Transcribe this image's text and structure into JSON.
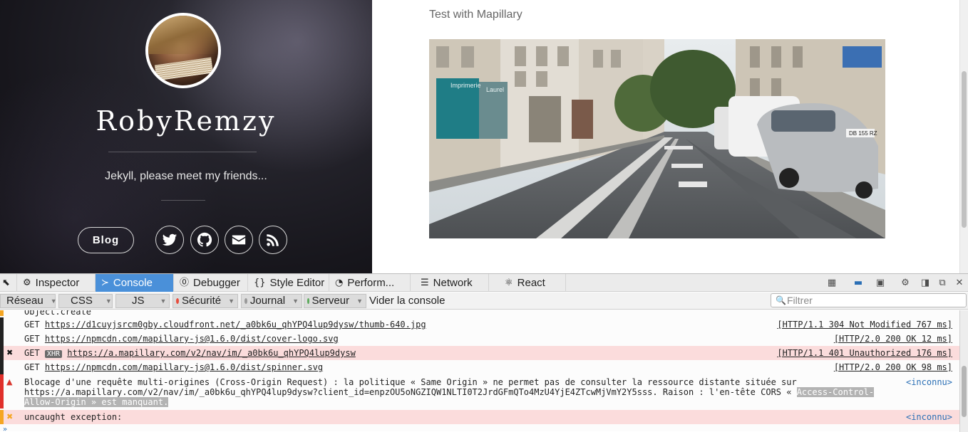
{
  "site": {
    "title": "RobyRemzy",
    "tagline": "Jekyll, please meet my friends...",
    "blog_label": "Blog",
    "social": [
      "twitter-icon",
      "github-icon",
      "envelope-icon",
      "rss-icon"
    ],
    "post_title": "Test with Mapillary",
    "shop_sign_1": "Imprimerie",
    "shop_sign_2": "Laurel",
    "car_plate": "DB 155 RZ"
  },
  "devtools": {
    "tabs": [
      "Inspector",
      "Console",
      "Debugger",
      "Style Editor",
      "Perform...",
      "Network",
      "React"
    ],
    "active_tab": "Console",
    "filters": {
      "reseau": "Réseau",
      "css": "CSS",
      "js": "JS",
      "securite": "Sécurité",
      "journal": "Journal",
      "serveur": "Serveur",
      "clear": "Vider la console",
      "placeholder": "Filtrer"
    },
    "colors": {
      "reseau": "#222222",
      "css": "#29a8e6",
      "js": "#f39c12",
      "securite": "#e74c3c",
      "journal": "#999999",
      "serveur": "#5aa95a"
    },
    "log": {
      "row0": "Object.create",
      "row1_method": "GET",
      "row1_url": "https://d1cuyjsrcm0gby.cloudfront.net/_a0bk6u_qhYPQ4lup9dysw/thumb-640.jpg",
      "row1_status": "[HTTP/1.1 304 Not Modified 767 ms]",
      "row2_method": "GET",
      "row2_url": "https://npmcdn.com/mapillary-js@1.6.0/dist/cover-logo.svg",
      "row2_status": "[HTTP/2.0 200 OK 12 ms]",
      "row3_method": "GET",
      "row3_tag": "XHR",
      "row3_url": "https://a.mapillary.com/v2/nav/im/_a0bk6u_qhYPQ4lup9dysw",
      "row3_status": "[HTTP/1.1 401 Unauthorized 176 ms]",
      "row4_method": "GET",
      "row4_url": "https://npmcdn.com/mapillary-js@1.6.0/dist/spinner.svg",
      "row4_status": "[HTTP/2.0 200 OK 98 ms]",
      "warn_line1": "Blocage d'une requête multi-origines (Cross-Origin Request) : la politique « Same Origin » ne permet pas de consulter la ressource distante située sur",
      "warn_line2a": "https://a.mapillary.com/v2/nav/im/_a0bk6u_qhYPQ4lup9dysw?client_id=enpzOU5oNGZIQW1NLTI0T2JrdGFmQTo4MzU4YjE4ZTcwMjVmY2Y5sss. Raison : l'en-tête CORS « ",
      "warn_line2b": "Access-Control-",
      "warn_line3a": "Allow-Origin » est manquant.",
      "warn_src": "<inconnu>",
      "error_text": "uncaught exception:",
      "error_src": "<inconnu>"
    }
  }
}
